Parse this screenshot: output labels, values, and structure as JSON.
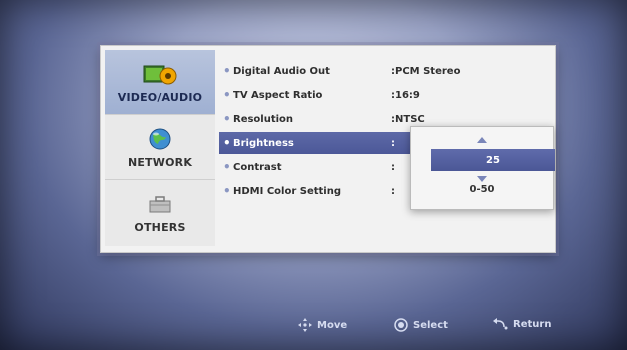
{
  "sidebar": {
    "categories": [
      {
        "label": "VIDEO/AUDIO",
        "icon": "video-audio-icon",
        "selected": true
      },
      {
        "label": "NETWORK",
        "icon": "globe-icon",
        "selected": false
      },
      {
        "label": "OTHERS",
        "icon": "toolbox-icon",
        "selected": false
      }
    ]
  },
  "settings": [
    {
      "label": "Digital Audio Out",
      "value": ":PCM Stereo"
    },
    {
      "label": "TV Aspect Ratio",
      "value": ":16:9"
    },
    {
      "label": "Resolution",
      "value": ":NTSC"
    },
    {
      "label": "Brightness",
      "value": ":",
      "highlighted": true
    },
    {
      "label": "Contrast",
      "value": ":"
    },
    {
      "label": "HDMI Color Setting",
      "value": ":"
    }
  ],
  "popup": {
    "value": "25",
    "range": "0-50"
  },
  "footer": {
    "move": "Move",
    "select": "Select",
    "return": "Return"
  },
  "colors": {
    "highlight": "#4f5b9b",
    "background": "#9aa3c6",
    "menu_bg": "#f2f2f2"
  }
}
